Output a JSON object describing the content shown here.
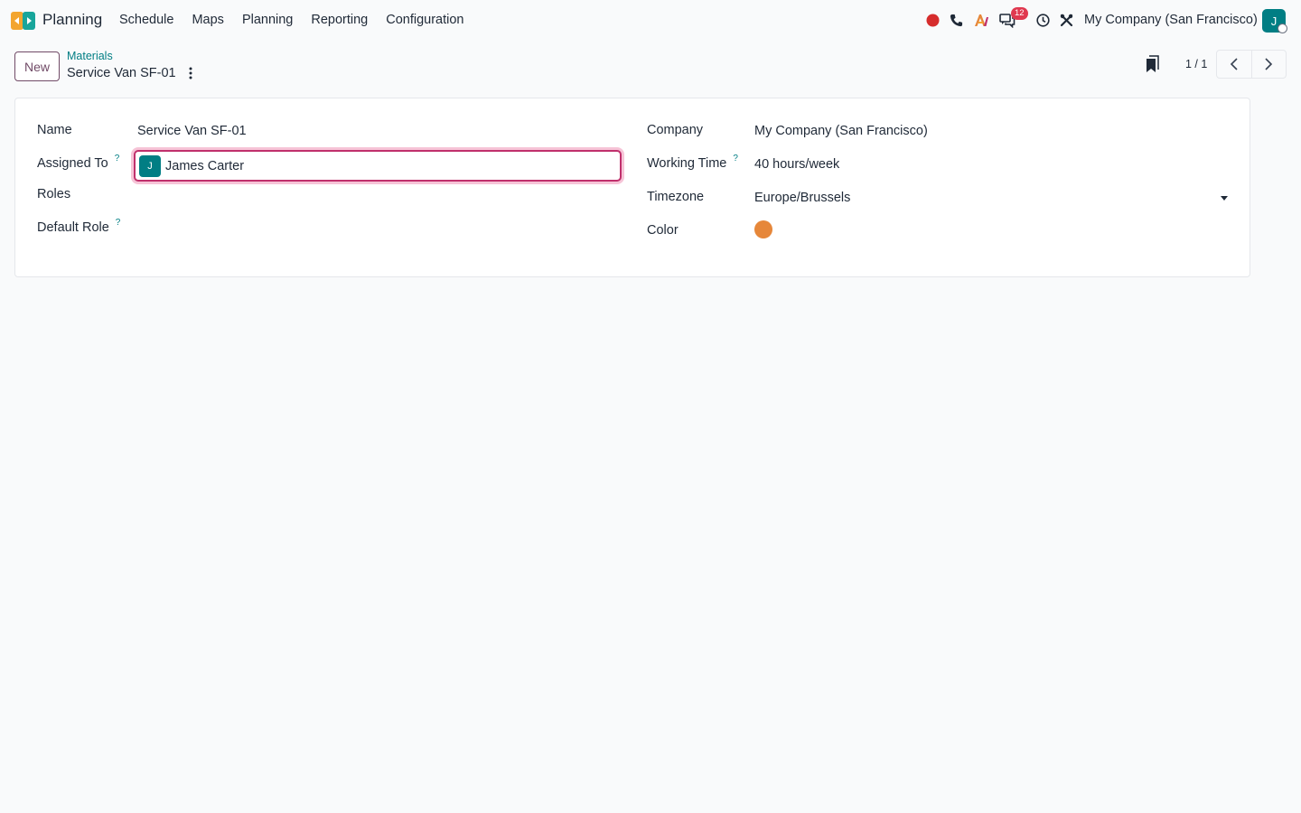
{
  "nav": {
    "app_name": "Planning",
    "menu": [
      "Schedule",
      "Maps",
      "Planning",
      "Reporting",
      "Configuration"
    ],
    "messages_badge": "12",
    "company": "My Company (San Francisco)",
    "user_initial": "J"
  },
  "control_panel": {
    "new_label": "New",
    "breadcrumb_parent": "Materials",
    "breadcrumb_current": "Service Van SF-01",
    "pager": "1 / 1"
  },
  "form": {
    "name_label": "Name",
    "name_value": "Service Van SF-01",
    "assigned_label": "Assigned To",
    "assigned_initial": "J",
    "assigned_value": "James Carter",
    "roles_label": "Roles",
    "default_role_label": "Default Role",
    "company_label": "Company",
    "company_value": "My Company (San Francisco)",
    "working_time_label": "Working Time",
    "working_time_value": "40 hours/week",
    "timezone_label": "Timezone",
    "timezone_value": "Europe/Brussels",
    "color_label": "Color",
    "help_mark": "?"
  },
  "colors": {
    "brand": "#714b67",
    "accent": "#017e84",
    "focus": "#c0306c",
    "record_color": "#e6873a",
    "recording_dot": "#d62c2c"
  }
}
